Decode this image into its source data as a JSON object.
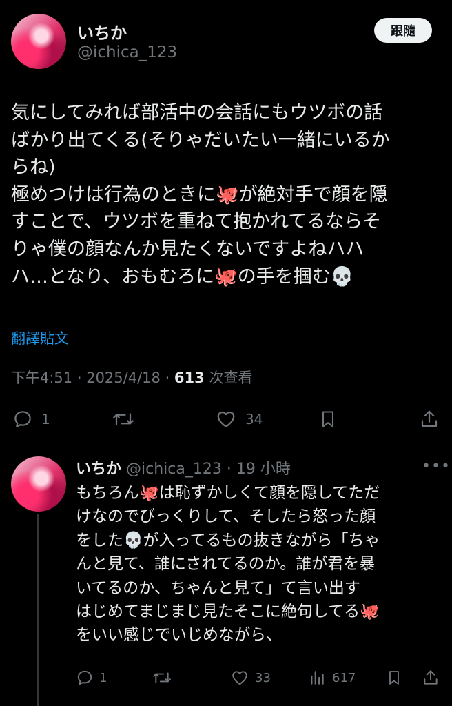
{
  "tweet": {
    "author_name": "いちか",
    "author_handle": "@ichica_123",
    "follow_label": "跟隨",
    "text_lines": [
      "気にしてみれば部活中の会話にもウツボの話",
      "ばかり出てくる(そりゃだいたい一緒にいるか",
      "らね)",
      "極めつけは行為のときに🐙が絶対手で顔を隠",
      "すことで、ウツボを重ねて抱かれてるならそ",
      "りゃ僕の顔なんか見たくないですよねハハ",
      "ハ…となり、おもむろに🐙の手を掴む💀"
    ],
    "translate_label": "翻譯貼文",
    "time": "下午4:51",
    "date": "2025/4/18",
    "views_count": "613",
    "views_label": "次查看",
    "replies": "1",
    "likes": "34"
  },
  "reply": {
    "author_name": "いちか",
    "author_handle": "@ichica_123",
    "age": "19 小時",
    "text_lines": [
      "もちろん🐙は恥ずかしくて顔を隠してただ",
      "けなのでびっくりして、そしたら怒った顔",
      "をした💀が入ってるもの抜きながら「ちゃ",
      "んと見て、誰にされてるのか。誰が君を暴",
      "いてるのか、ちゃんと見て」て言い出す",
      "はじめてまじまじ見たそこに絶句してる🐙",
      "をいい感じでいじめながら、"
    ],
    "replies": "1",
    "likes": "33",
    "views": "617"
  },
  "colors": {
    "background": "#000000",
    "text": "#e7e9ea",
    "muted": "#71767b",
    "link": "#1d9bf0",
    "follow_bg": "#eff3f4"
  },
  "icons": [
    "reply-icon",
    "retweet-icon",
    "like-icon",
    "bookmark-icon",
    "share-icon",
    "views-icon",
    "more-icon"
  ]
}
